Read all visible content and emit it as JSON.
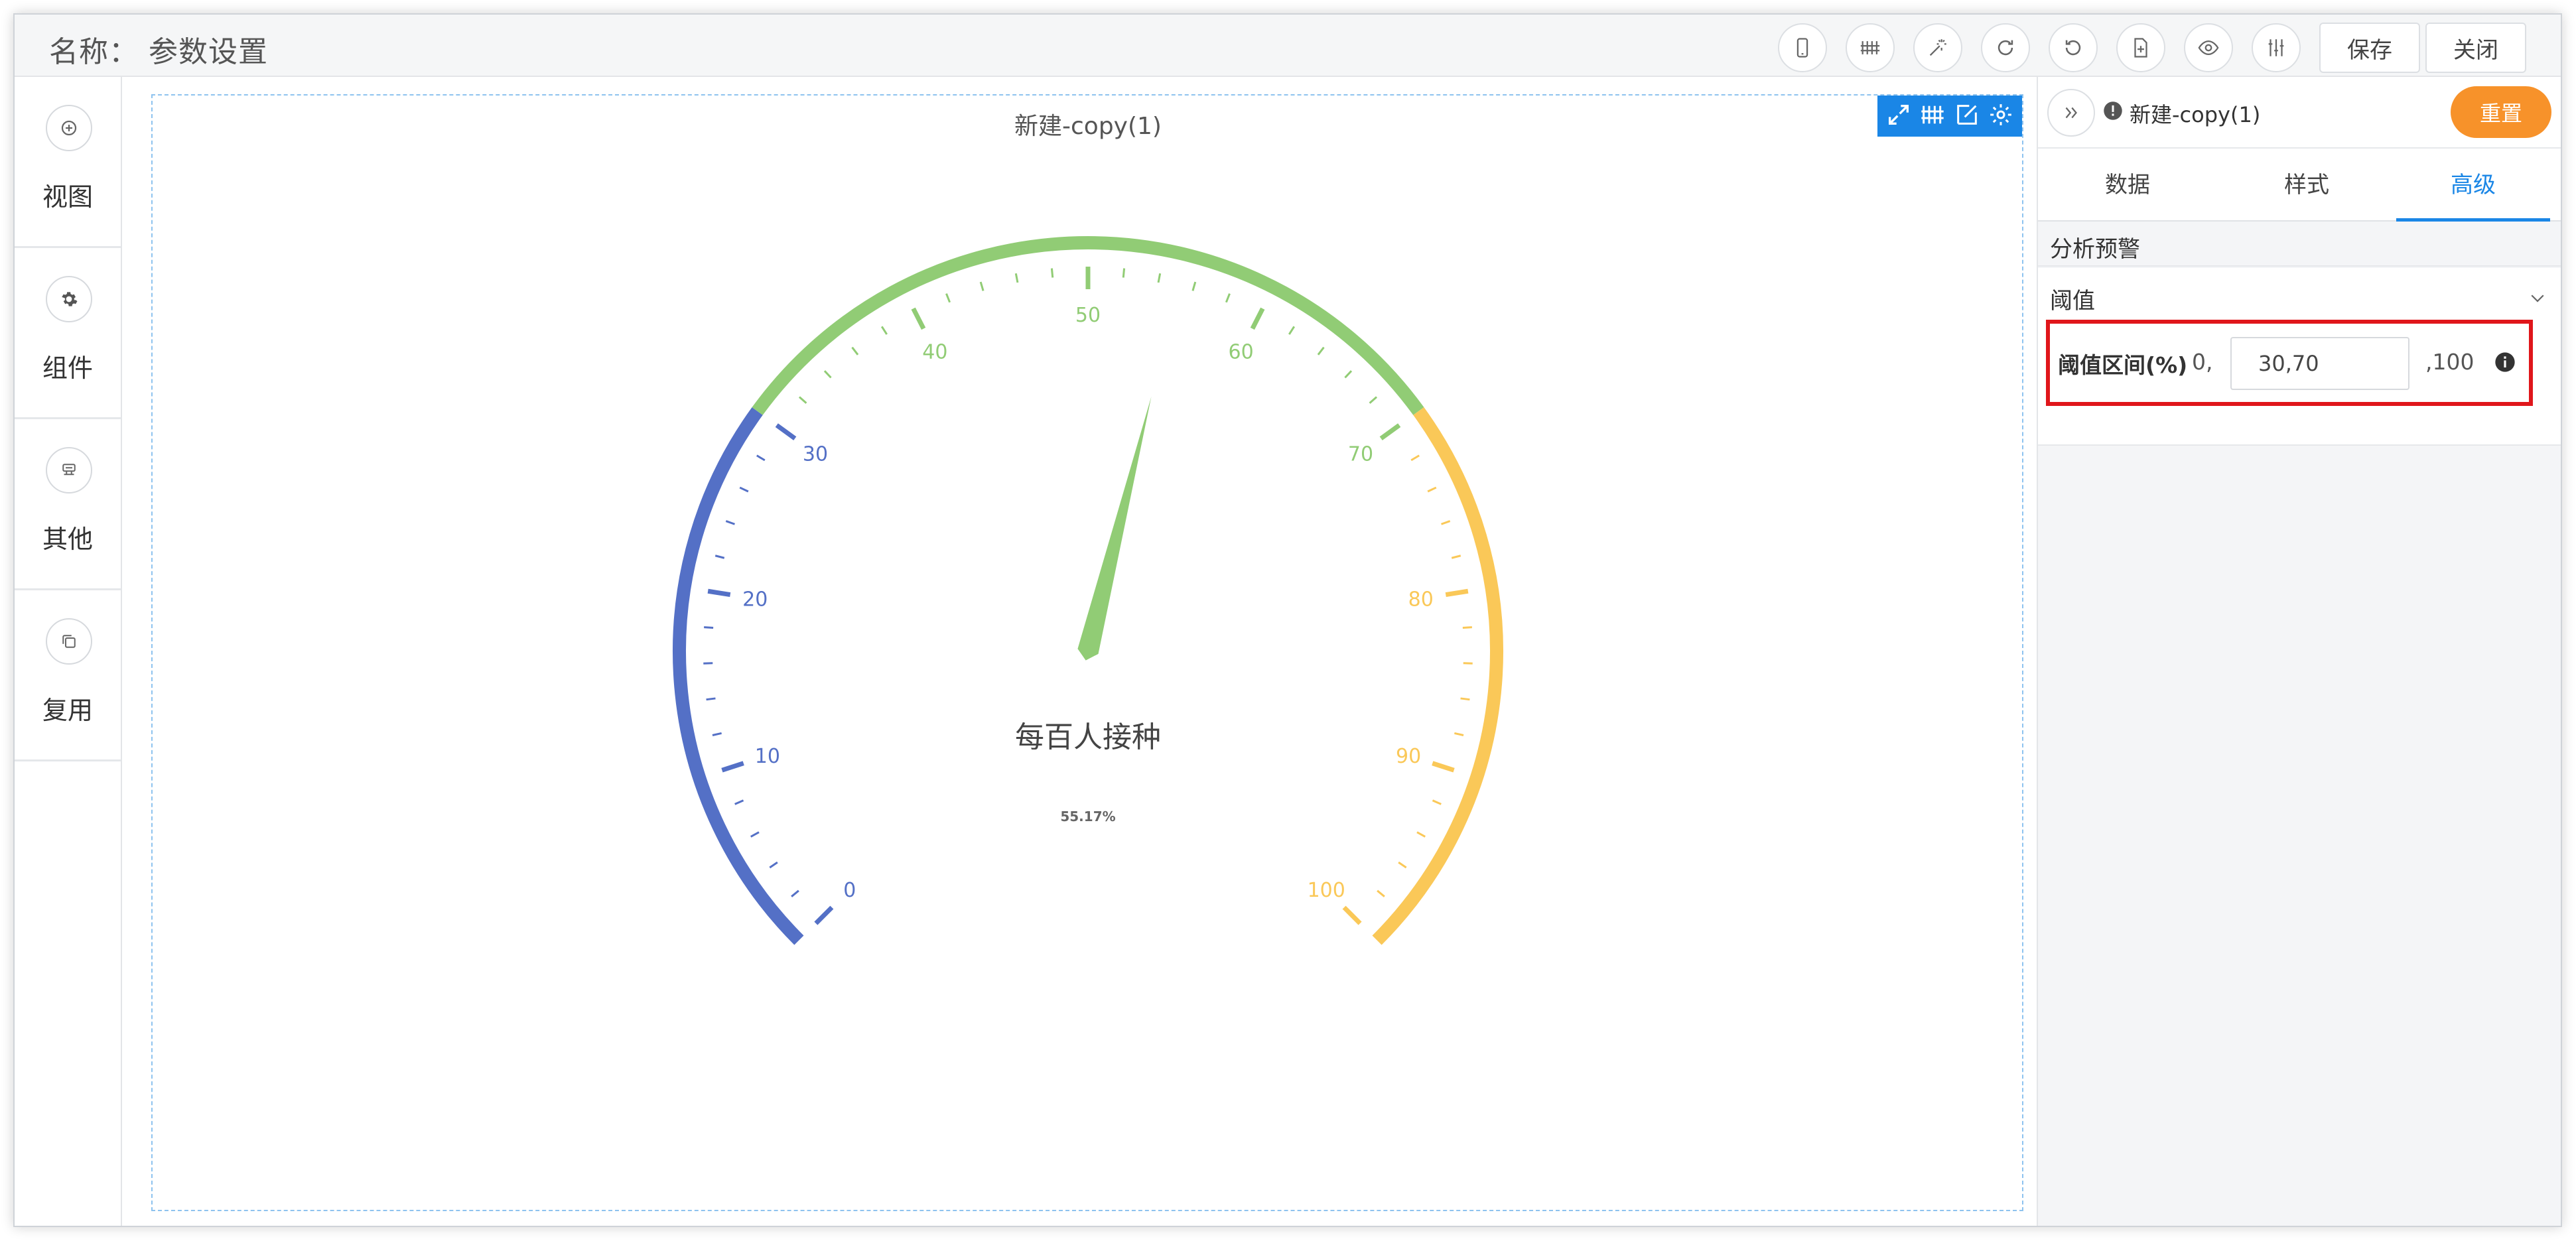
{
  "header": {
    "title": "名称： 参数设置",
    "toolbar_icons": [
      "mobile-icon",
      "grid-icon",
      "magic-icon",
      "redo-icon",
      "undo-icon",
      "export-icon",
      "preview-icon",
      "settings-sliders-icon"
    ],
    "save_label": "保存",
    "close_label": "关闭"
  },
  "sidebar": {
    "items": [
      {
        "label": "视图",
        "icon": "plus-circle-icon"
      },
      {
        "label": "组件",
        "icon": "gear-icon"
      },
      {
        "label": "其他",
        "icon": "stamp-icon"
      },
      {
        "label": "复用",
        "icon": "copy-icon"
      }
    ]
  },
  "chart_data": {
    "type": "gauge",
    "title": "新建-copy(1)",
    "min": 0,
    "max": 100,
    "value": 55.17,
    "value_label": "55.17%",
    "center_label": "每百人接种",
    "tick_labels": [
      "0",
      "10",
      "20",
      "30",
      "40",
      "50",
      "60",
      "70",
      "80",
      "90",
      "100"
    ],
    "bands": [
      {
        "from": 0,
        "to": 30,
        "color": "#5470c6"
      },
      {
        "from": 30,
        "to": 70,
        "color": "#91cc75"
      },
      {
        "from": 70,
        "to": 100,
        "color": "#fac858"
      }
    ],
    "pointer_color": "#91cc75"
  },
  "panel": {
    "title": "新建-copy(1)",
    "reset_label": "重置",
    "tabs": [
      {
        "label": "数据",
        "active": false
      },
      {
        "label": "样式",
        "active": false
      },
      {
        "label": "高级",
        "active": true
      }
    ],
    "section_label": "分析预警",
    "threshold": {
      "heading": "阈值",
      "label": "阈值区间(%)",
      "prefix": "0,",
      "value": "30,70",
      "suffix": ",100"
    }
  },
  "colors": {
    "accent": "#1a86e6",
    "reset": "#f7922a",
    "highlight": "#e0161b"
  }
}
